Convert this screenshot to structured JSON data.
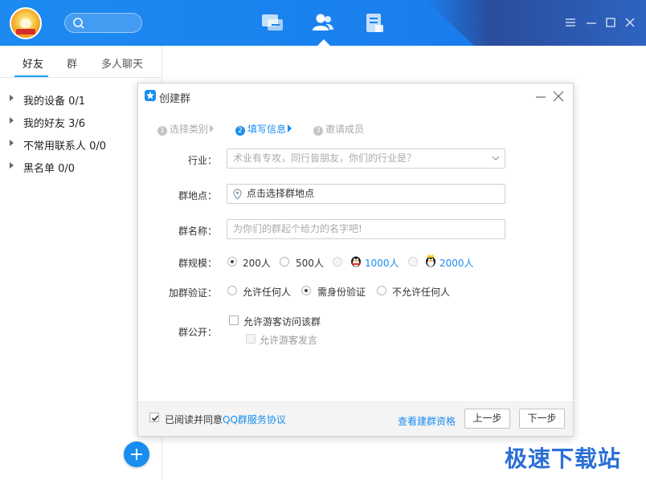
{
  "topbar": {
    "nav": [
      "messages-icon",
      "contacts-icon",
      "apps-icon"
    ],
    "active_nav": "contacts-icon"
  },
  "sidebar": {
    "tabs": [
      {
        "label": "好友"
      },
      {
        "label": "群"
      },
      {
        "label": "多人聊天"
      }
    ],
    "groups": [
      {
        "label": "我的设备 0/1"
      },
      {
        "label": "我的好友 3/6"
      },
      {
        "label": "不常用联系人 0/0"
      },
      {
        "label": "黑名单 0/0"
      }
    ]
  },
  "dialog": {
    "title": "创建群",
    "steps": [
      {
        "num": "1",
        "label": "选择类别"
      },
      {
        "num": "2",
        "label": "填写信息"
      },
      {
        "num": "3",
        "label": "邀请成员"
      }
    ],
    "active_step": 2,
    "industry": {
      "label": "行业：",
      "placeholder": "术业有专攻，同行皆朋友，你们的行业是？"
    },
    "location": {
      "label": "群地点：",
      "value": "点击选择群地点"
    },
    "name": {
      "label": "群名称：",
      "placeholder": "为你们的群起个给力的名字吧!"
    },
    "size": {
      "label": "群规模：",
      "options": [
        "200人",
        "500人",
        "1000人",
        "2000人"
      ],
      "selected": "200人"
    },
    "verify": {
      "label": "加群验证：",
      "options": [
        "允许任何人",
        "需身份验证",
        "不允许任何人"
      ],
      "selected": "需身份验证"
    },
    "public": {
      "label": "群公开：",
      "allow_visitor": "允许游客访问该群",
      "allow_visitor_speak": "允许游客发言"
    },
    "footer": {
      "agree_prefix": "已阅读并同意",
      "agree_link": "QQ群服务协议",
      "qualification_link": "查看建群资格",
      "prev_button": "上一步",
      "next_button": "下一步"
    }
  },
  "watermark": "极速下载站",
  "colors": {
    "accent": "#1a8df0",
    "topbar": "#1c8af0"
  }
}
